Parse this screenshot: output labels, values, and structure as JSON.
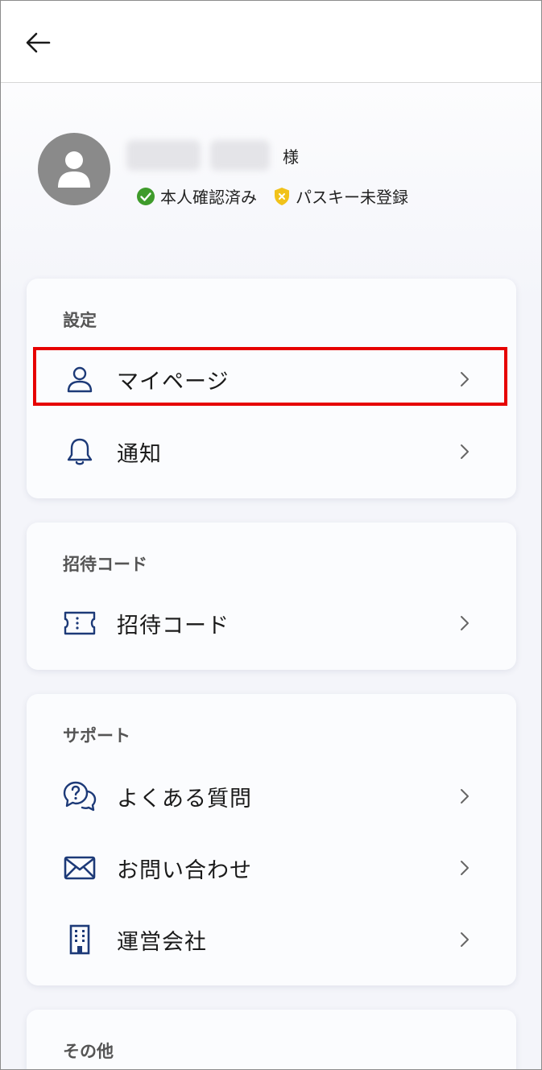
{
  "header": {
    "back_icon": "arrow-left-icon"
  },
  "profile": {
    "honorific": "様",
    "status": [
      {
        "label": "本人確認済み",
        "icon": "check-circle-icon",
        "color": "#3f9b2b"
      },
      {
        "label": "パスキー未登録",
        "icon": "shield-x-icon",
        "color": "#f1c21a"
      }
    ]
  },
  "sections": {
    "settings": {
      "title": "設定",
      "items": [
        {
          "label": "マイページ",
          "icon": "user-icon"
        },
        {
          "label": "通知",
          "icon": "bell-icon"
        }
      ]
    },
    "invite": {
      "title": "招待コード",
      "items": [
        {
          "label": "招待コード",
          "icon": "ticket-icon"
        }
      ]
    },
    "support": {
      "title": "サポート",
      "items": [
        {
          "label": "よくある質問",
          "icon": "faq-chat-icon"
        },
        {
          "label": "お問い合わせ",
          "icon": "mail-icon"
        },
        {
          "label": "運営会社",
          "icon": "building-icon"
        }
      ]
    },
    "other": {
      "title": "その他"
    }
  },
  "colors": {
    "accent_icon": "#1d3a78",
    "highlight": "#e60000",
    "chevron": "#666666"
  }
}
